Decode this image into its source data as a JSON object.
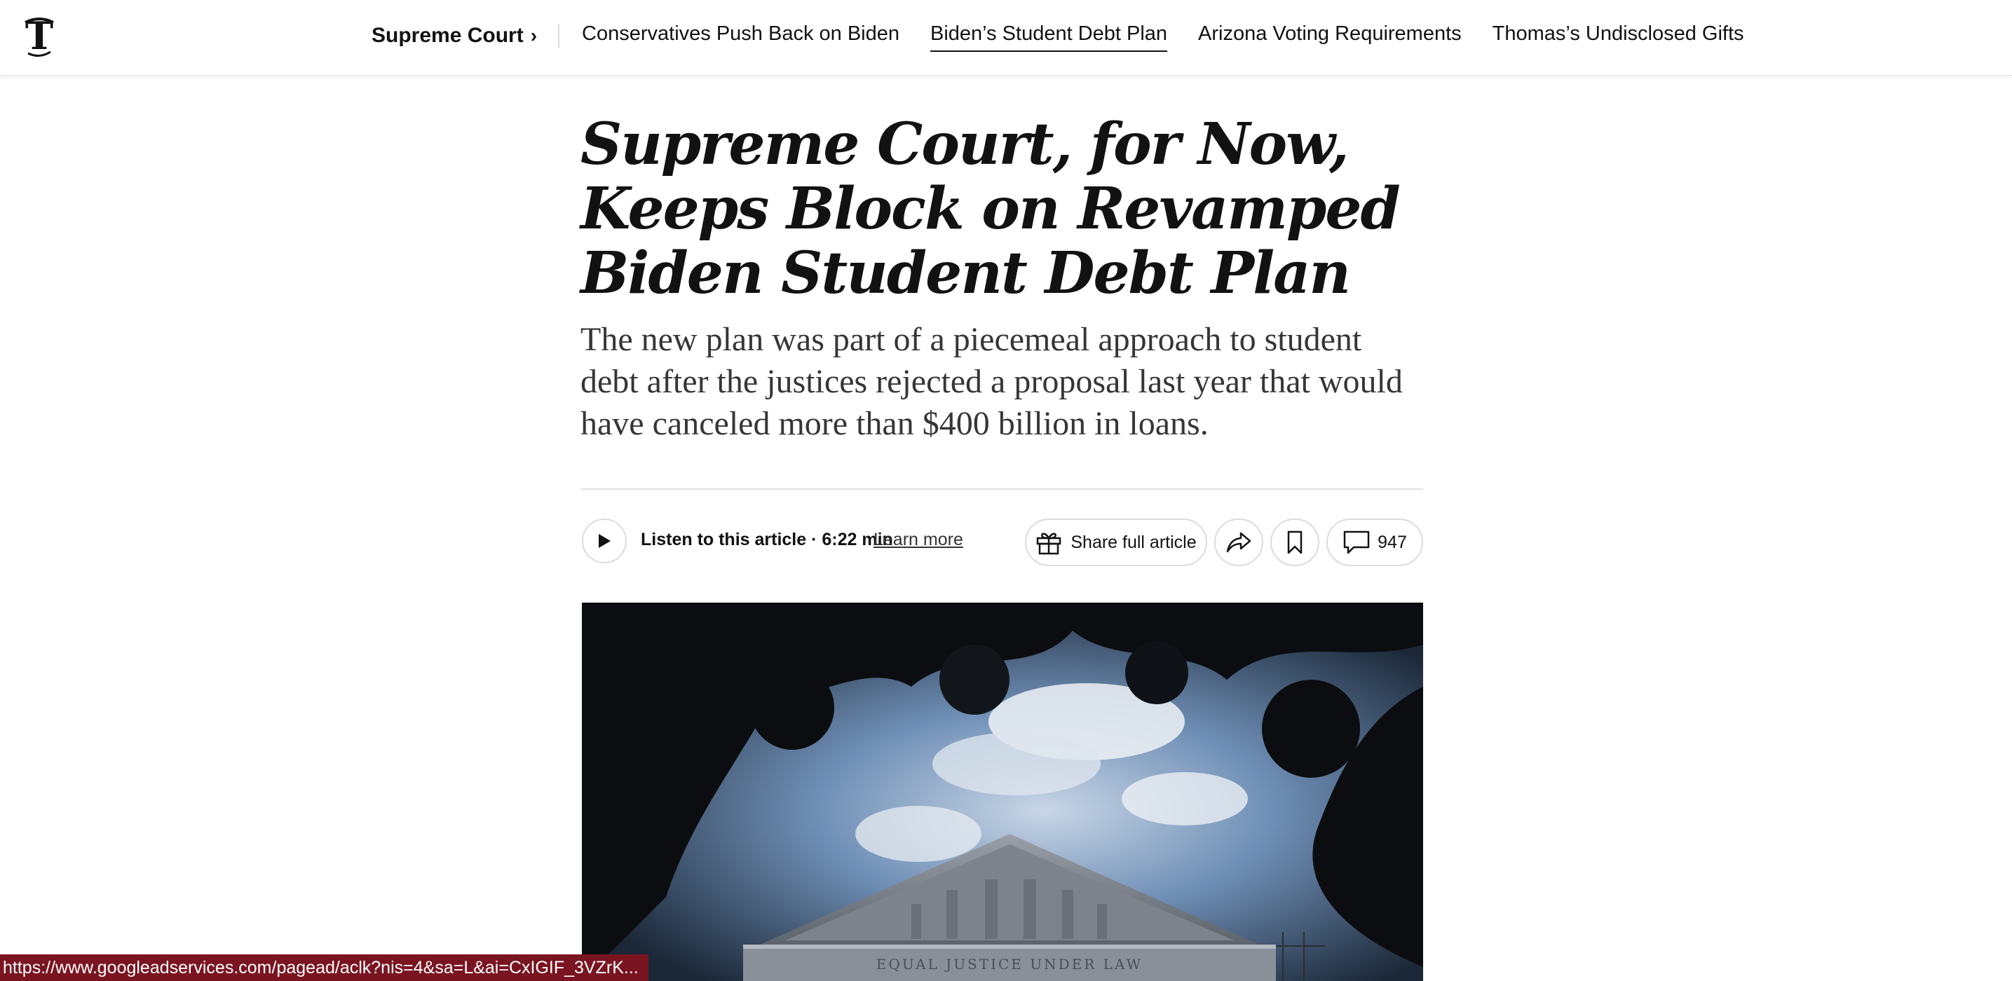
{
  "nav": {
    "logo": "nyt-logo",
    "section": "Supreme Court",
    "section_chevron": "›",
    "links": [
      {
        "label": "Conservatives Push Back on Biden",
        "active": false
      },
      {
        "label": "Biden’s Student Debt Plan",
        "active": true
      },
      {
        "label": "Arizona Voting Requirements",
        "active": false
      },
      {
        "label": "Thomas’s Undisclosed Gifts",
        "active": false
      }
    ]
  },
  "article": {
    "headline": "Supreme Court, for Now, Keeps Block on Revamped Biden Student Debt Plan",
    "summary": "The new plan was part of a piecemeal approach to student debt after the justices rejected a proposal last year that would have canceled more than $400 billion in loans."
  },
  "toolbar": {
    "listen_label": "Listen to this article · 6:22 min",
    "learn_more": "Learn more",
    "share_full": "Share full article",
    "comment_count": "947",
    "icons": {
      "play": "play-icon",
      "gift": "gift-icon",
      "share": "share-icon",
      "bookmark": "bookmark-icon",
      "comment": "comment-icon"
    }
  },
  "hero": {
    "inscription": "EQUAL JUSTICE UNDER LAW"
  },
  "status_bar": {
    "url": "https://www.googleadservices.com/pagead/aclk?nis=4&sa=L&ai=CxIGIF_3VZrK..."
  },
  "colors": {
    "text": "#121212",
    "border": "#dcdcdc",
    "status_bg": "#7a1420"
  }
}
